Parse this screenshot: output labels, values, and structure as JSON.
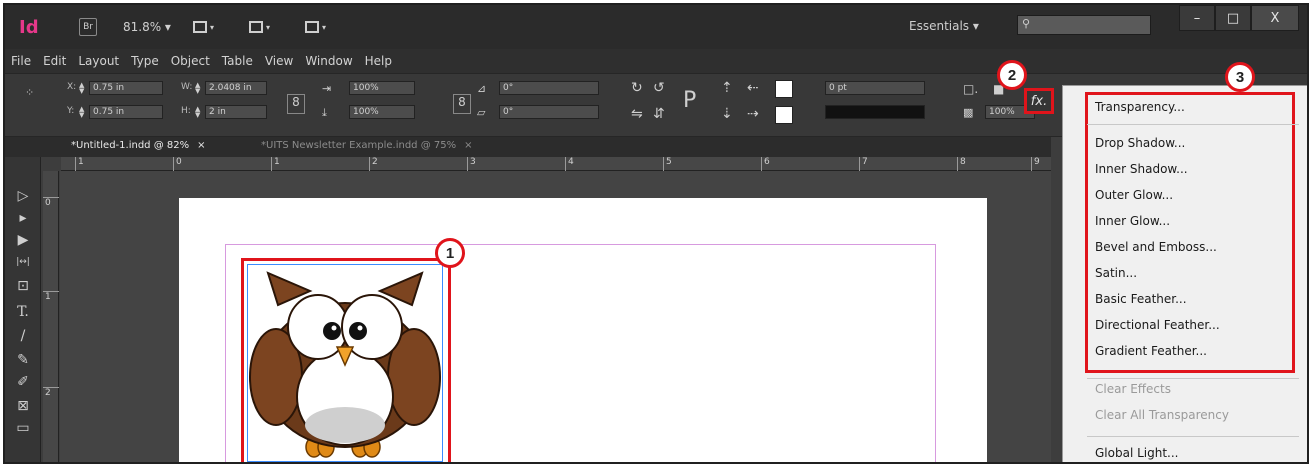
{
  "app": {
    "logo": "Id",
    "bridge": "Br",
    "zoom": "81.8% ▾",
    "workspace": "Essentials ▾"
  },
  "window_buttons": {
    "minimize": "–",
    "maximize": "□",
    "close": "X"
  },
  "menubar": [
    "File",
    "Edit",
    "Layout",
    "Type",
    "Object",
    "Table",
    "View",
    "Window",
    "Help"
  ],
  "control": {
    "x": "0.75 in",
    "y": "0.75 in",
    "w": "2.0408 in",
    "h": "2 in",
    "x_label": "X:",
    "y_label": "Y:",
    "w_label": "W:",
    "h_label": "H:",
    "scale_x": "100%",
    "scale_y": "100%",
    "angle": "0°",
    "shear": "0°",
    "stroke": "0 pt",
    "opacity": "100%",
    "fx_label": "fx."
  },
  "tabs": [
    {
      "label": "*Untitled-1.indd @ 82%",
      "close": "×"
    },
    {
      "label": "*UITS Newsletter Example.indd @ 75%",
      "close": "×"
    }
  ],
  "ruler": {
    "h": [
      "1",
      "0",
      "1",
      "2",
      "3",
      "4",
      "5",
      "6",
      "7",
      "8",
      "9"
    ],
    "v": [
      "0",
      "1",
      "2"
    ]
  },
  "tools": [
    "▷",
    "▸",
    "▶",
    "|↔|",
    "⊡",
    "T.",
    "/",
    "✎",
    "✐",
    "⊠",
    "▭"
  ],
  "callouts": [
    "1",
    "2",
    "3"
  ],
  "fx_menu": {
    "items": [
      "Transparency...",
      "Drop Shadow...",
      "Inner Shadow...",
      "Outer Glow...",
      "Inner Glow...",
      "Bevel and Emboss...",
      "Satin...",
      "Basic Feather...",
      "Directional Feather...",
      "Gradient Feather..."
    ],
    "disabled": [
      "Clear Effects",
      "Clear All Transparency"
    ],
    "last": "Global Light..."
  },
  "colors": {
    "highlight": "#e0141b",
    "selection": "#3b8cff",
    "margin_guide": "#d79adf",
    "app_pink": "#e6388a"
  }
}
